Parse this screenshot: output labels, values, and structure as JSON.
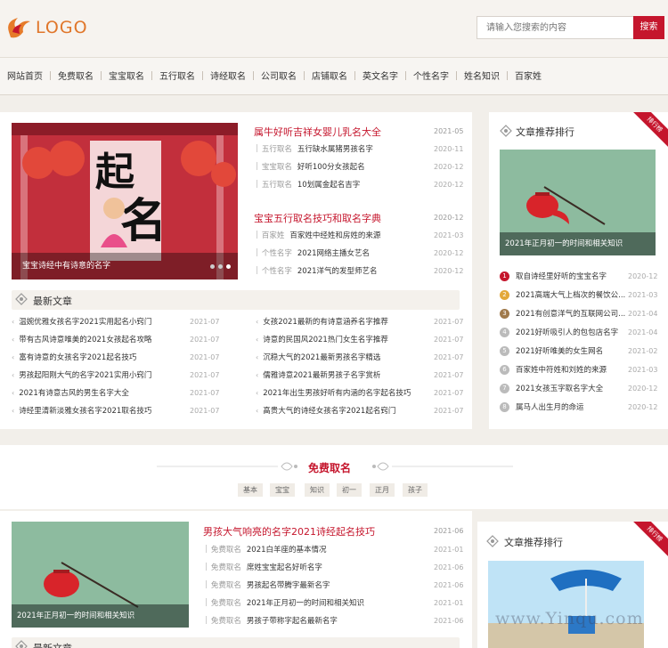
{
  "header": {
    "logo_text": "LOGO",
    "search_placeholder": "请输入您搜索的内容",
    "search_button": "搜索"
  },
  "nav": [
    "网站首页",
    "免费取名",
    "宝宝取名",
    "五行取名",
    "诗经取名",
    "公司取名",
    "店铺取名",
    "英文名字",
    "个性名字",
    "姓名知识",
    "百家姓"
  ],
  "slider": {
    "caption": "宝宝诗经中有诗意的名字"
  },
  "headlines": [
    {
      "title": "属牛好听吉祥女婴儿乳名大全",
      "date": "2021-05",
      "rows": [
        {
          "cat": "五行取名",
          "title": "五行缺水属猪男孩名字",
          "date": "2020-11"
        },
        {
          "cat": "宝宝取名",
          "title": "好听100分女孩起名",
          "date": "2020-12"
        },
        {
          "cat": "五行取名",
          "title": "10划属金起名吉字",
          "date": "2020-12"
        }
      ]
    },
    {
      "title": "宝宝五行取名技巧和取名字典",
      "date": "2020-12",
      "rows": [
        {
          "cat": "百家姓",
          "title": "百家姓中经姓和房姓的来源",
          "date": "2021-03"
        },
        {
          "cat": "个性名字",
          "title": "2021网络主播女艺名",
          "date": "2020-12"
        },
        {
          "cat": "个性名字",
          "title": "2021洋气的发型师艺名",
          "date": "2020-12"
        }
      ]
    }
  ],
  "latest": {
    "title": "最新文章",
    "left": [
      {
        "title": "温婉优雅女孩名字2021实用起名小窍门",
        "date": "2021-07"
      },
      {
        "title": "带有古风诗意唯美的2021女孩起名攻略",
        "date": "2021-07"
      },
      {
        "title": "富有诗意的女孩名字2021起名技巧",
        "date": "2021-07"
      },
      {
        "title": "男孩起阳刚大气的名字2021实用小窍门",
        "date": "2021-07"
      },
      {
        "title": "2021有诗意古风的男生名字大全",
        "date": "2021-07"
      },
      {
        "title": "诗经里清新淡雅女孩名字2021取名技巧",
        "date": "2021-07"
      }
    ],
    "right": [
      {
        "title": "女孩2021最新的有诗意涵养名字推荐",
        "date": "2021-07"
      },
      {
        "title": "诗意的民国风2021热门女生名字推荐",
        "date": "2021-07"
      },
      {
        "title": "沉稳大气的2021最新男孩名字精选",
        "date": "2021-07"
      },
      {
        "title": "儒雅诗意2021最新男孩子名字赏析",
        "date": "2021-07"
      },
      {
        "title": "2021年出生男孩好听有内涵的名字起名技巧",
        "date": "2021-07"
      },
      {
        "title": "高贵大气的诗经女孩名字2021起名窍门",
        "date": "2021-07"
      }
    ]
  },
  "ranking": {
    "title": "文章推荐排行",
    "badge": "排行榜",
    "image_caption": "2021年正月初一的时间和相关知识",
    "items": [
      {
        "num": "1",
        "title": "取自诗经里好听的宝宝名字",
        "date": "2020-12"
      },
      {
        "num": "2",
        "title": "2021高端大气上档次的餐饮公...",
        "date": "2021-03"
      },
      {
        "num": "3",
        "title": "2021有创意洋气的互联网公司...",
        "date": "2021-04"
      },
      {
        "num": "4",
        "title": "2021好听吸引人的包包店名字",
        "date": "2021-04"
      },
      {
        "num": "5",
        "title": "2021好听唯美的女生网名",
        "date": "2021-02"
      },
      {
        "num": "6",
        "title": "百家姓中符姓和刘姓的来源",
        "date": "2021-03"
      },
      {
        "num": "7",
        "title": "2021女孩玉字取名字大全",
        "date": "2020-12"
      },
      {
        "num": "8",
        "title": "属马人出生月的命运",
        "date": "2020-12"
      }
    ],
    "num_colors": [
      "#c5162d",
      "#e3a83a",
      "#a07a4c",
      "#bbbbbb"
    ]
  },
  "section2": {
    "title": "免费取名",
    "tags": [
      "基本",
      "宝宝",
      "知识",
      "初一",
      "正月",
      "孩子"
    ],
    "image_caption": "2021年正月初一的时间和相关知识",
    "headline": {
      "title": "男孩大气响亮的名字2021诗经起名技巧",
      "date": "2021-06"
    },
    "rows": [
      {
        "cat": "免费取名",
        "title": "2021白羊座的基本情况",
        "date": "2021-01"
      },
      {
        "cat": "免费取名",
        "title": "席姓宝宝起名好听名字",
        "date": "2021-06"
      },
      {
        "cat": "免费取名",
        "title": "男孩起名带腾字最新名字",
        "date": "2021-06"
      },
      {
        "cat": "免费取名",
        "title": "2021年正月初一的时间和相关知识",
        "date": "2021-01"
      },
      {
        "cat": "免费取名",
        "title": "男孩子带称字起名最新名字",
        "date": "2021-06"
      }
    ],
    "latest_title": "最新文章",
    "ranking_title": "文章推荐排行",
    "ranking_badge": "排行榜"
  },
  "watermark": "www.Yinqu.com"
}
